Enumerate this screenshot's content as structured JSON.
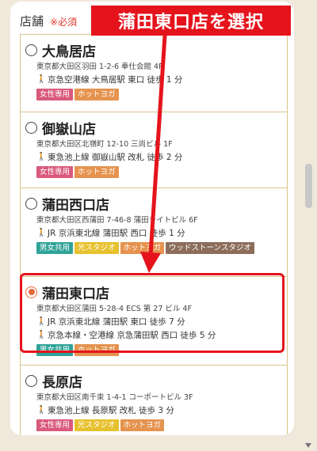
{
  "section": {
    "label": "店舗",
    "required": "※必須"
  },
  "annotation": {
    "callout": "蒲田東口店を選択"
  },
  "stores": [
    {
      "name": "大鳥居店",
      "address": "東京都大田区羽田 1-2-6 奉仕会館 4F",
      "access": [
        "京急空港線 大鳥居駅 東口 徒歩 1 分"
      ],
      "tags": [
        "女性専用",
        "ホットヨガ"
      ],
      "selected": false
    },
    {
      "name": "御嶽山店",
      "address": "東京都大田区北嶺町 12-10 三尚ビル 1F",
      "access": [
        "東急池上線 御嶽山駅 改札 徒歩 2 分"
      ],
      "tags": [
        "女性専用",
        "ホットヨガ"
      ],
      "selected": false
    },
    {
      "name": "蒲田西口店",
      "address": "東京都大田区西蒲田 7-46-8 蒲田ライトビル 6F",
      "access": [
        "JR 京浜東北線 蒲田駅 西口 徒歩 1 分"
      ],
      "tags": [
        "男女共用",
        "光スタジオ",
        "ホットヨガ",
        "ウッドストーンスタジオ"
      ],
      "selected": false
    },
    {
      "name": "蒲田東口店",
      "address": "東京都大田区蒲田 5-28-4 ECS 第 27 ビル 4F",
      "access": [
        "JR 京浜東北線 蒲田駅 東口 徒歩 7 分",
        "京急本線・空港線 京急蒲田駅 西口 徒歩 5 分"
      ],
      "tags": [
        "男女共用",
        "ホットヨガ"
      ],
      "selected": true
    },
    {
      "name": "長原店",
      "address": "東京都大田区南千束 1-4-1 コーポートビル 3F",
      "access": [
        "東急池上線 長原駅 改札 徒歩 3 分"
      ],
      "tags": [
        "女性専用",
        "光スタジオ",
        "ホットヨガ"
      ],
      "selected": false
    }
  ],
  "colors": {
    "accent_red": "#e5141c",
    "radio_selected": "#e46b3c",
    "border": "#d9c48c"
  }
}
